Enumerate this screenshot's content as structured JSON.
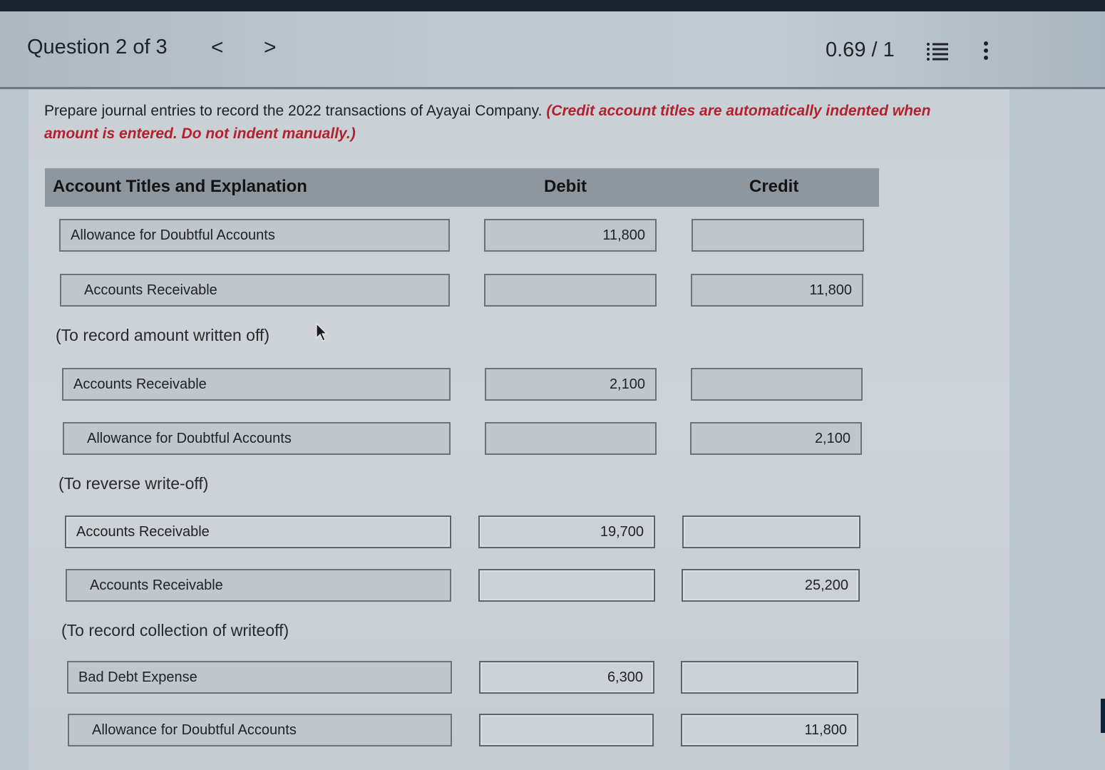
{
  "header": {
    "question_title": "Question 2 of 3",
    "prev_symbol": "<",
    "next_symbol": ">",
    "score": "0.69 / 1",
    "list_icon": "list-icon",
    "more_icon": "vertical-dots-icon"
  },
  "instructions": {
    "text": "Prepare journal entries to record the 2022 transactions of Ayayai Company.",
    "note": "(Credit account titles are automatically indented when amount is entered. Do not indent manually.)"
  },
  "table": {
    "columns": [
      "Account Titles and Explanation",
      "Debit",
      "Credit"
    ],
    "entries": [
      {
        "lines": [
          {
            "account": "Allowance for Doubtful Accounts",
            "debit": "11,800",
            "credit": ""
          },
          {
            "account": "Accounts Receivable",
            "debit": "",
            "credit": "11,800"
          }
        ],
        "explanation": "(To record amount written off)"
      },
      {
        "lines": [
          {
            "account": "Accounts Receivable",
            "debit": "2,100",
            "credit": ""
          },
          {
            "account": "Allowance for Doubtful Accounts",
            "debit": "",
            "credit": "2,100"
          }
        ],
        "explanation": "(To reverse write-off)"
      },
      {
        "lines": [
          {
            "account": "Accounts Receivable",
            "debit": "19,700",
            "credit": ""
          },
          {
            "account": "Accounts Receivable",
            "debit": "",
            "credit": "25,200"
          }
        ],
        "explanation": "(To record collection of writeoff)"
      },
      {
        "lines": [
          {
            "account": "Bad Debt Expense",
            "debit": "6,300",
            "credit": ""
          },
          {
            "account": "Allowance for Doubtful Accounts",
            "debit": "",
            "credit": "11,800"
          }
        ],
        "explanation": ""
      }
    ]
  },
  "colors": {
    "note_red": "#b2222e",
    "header_bar": "#8e979e"
  }
}
